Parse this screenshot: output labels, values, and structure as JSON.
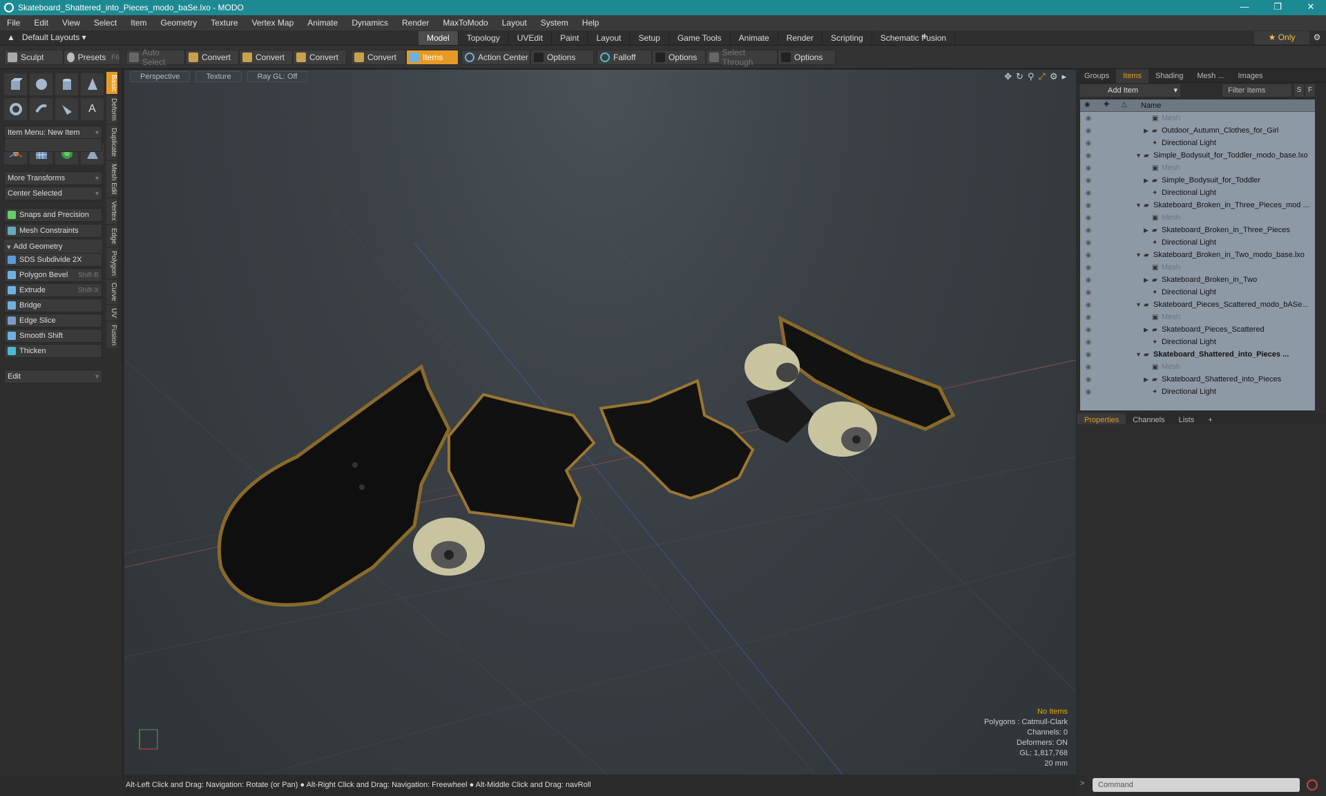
{
  "window": {
    "title": "Skateboard_Shattered_into_Pieces_modo_baSe.lxo - MODO"
  },
  "menu": [
    "File",
    "Edit",
    "View",
    "Select",
    "Item",
    "Geometry",
    "Texture",
    "Vertex Map",
    "Animate",
    "Dynamics",
    "Render",
    "MaxToModo",
    "Layout",
    "System",
    "Help"
  ],
  "layouts": "Default Layouts",
  "modetabs": [
    "Model",
    "Topology",
    "UVEdit",
    "Paint",
    "Layout",
    "Setup",
    "Game Tools",
    "Animate",
    "Render",
    "Scripting",
    "Schematic Fusion"
  ],
  "only_label": "Only",
  "toolbar": {
    "sculpt": "Sculpt",
    "presets": "Presets",
    "presets_key": "F6",
    "auto_select": "Auto Select",
    "convert1": "Convert",
    "convert2": "Convert",
    "convert3": "Convert",
    "convert4": "Convert",
    "items": "Items",
    "action_center": "Action Center",
    "options1": "Options",
    "falloff": "Falloff",
    "options2": "Options",
    "select_through": "Select Through",
    "options3": "Options"
  },
  "left": {
    "item_menu": "Item Menu: New Item",
    "more_transforms": "More Transforms",
    "center_selected": "Center Selected",
    "snaps": "Snaps and Precision",
    "mesh_constraints": "Mesh Constraints",
    "add_geometry": "Add Geometry",
    "tools": [
      {
        "label": "SDS Subdivide 2X",
        "key": ""
      },
      {
        "label": "Polygon Bevel",
        "key": "Shift-B"
      },
      {
        "label": "Extrude",
        "key": "Shift-X"
      },
      {
        "label": "Bridge",
        "key": ""
      },
      {
        "label": "Edge Slice",
        "key": ""
      },
      {
        "label": "Smooth Shift",
        "key": ""
      },
      {
        "label": "Thicken",
        "key": ""
      }
    ],
    "edit": "Edit"
  },
  "vtabs": [
    "Basic",
    "Deform",
    "Duplicate",
    "Mesh Edit",
    "Vertex",
    "Edge",
    "Polygon",
    "Curve",
    "UV",
    "Fusion"
  ],
  "viewport": {
    "perspective": "Perspective",
    "texture": "Texture",
    "raygl": "Ray GL: Off",
    "info": {
      "no_items": "No Items",
      "polygons": "Polygons : Catmull-Clark",
      "channels": "Channels: 0",
      "deformers": "Deformers: ON",
      "gl": "GL: 1,817,768",
      "scale": "20 mm"
    }
  },
  "status": "Alt-Left Click and Drag: Navigation: Rotate (or Pan) ●  Alt-Right Click and Drag: Navigation: Freewheel ●  Alt-Middle Click and Drag: navRoll",
  "right": {
    "tabs": [
      "Groups",
      "Items",
      "Shading",
      "Mesh ...",
      "Images"
    ],
    "add_item": "Add Item",
    "filter": "Filter Items",
    "name_col": "Name",
    "rows": [
      {
        "label": "Mesh",
        "indent": 2,
        "dim": true,
        "arrow": ""
      },
      {
        "label": "Outdoor_Autumn_Clothes_for_Girl",
        "indent": 2,
        "dim": false,
        "arrow": "▶"
      },
      {
        "label": "Directional Light",
        "indent": 2,
        "dim": false,
        "arrow": ""
      },
      {
        "label": "Simple_Bodysuit_for_Toddler_modo_base.lxo",
        "indent": 1,
        "dim": false,
        "arrow": "▼"
      },
      {
        "label": "Mesh",
        "indent": 2,
        "dim": true,
        "arrow": ""
      },
      {
        "label": "Simple_Bodysuit_for_Toddler",
        "indent": 2,
        "dim": false,
        "arrow": "▶"
      },
      {
        "label": "Directional Light",
        "indent": 2,
        "dim": false,
        "arrow": ""
      },
      {
        "label": "Skateboard_Broken_in_Three_Pieces_mod ...",
        "indent": 1,
        "dim": false,
        "arrow": "▼"
      },
      {
        "label": "Mesh",
        "indent": 2,
        "dim": true,
        "arrow": ""
      },
      {
        "label": "Skateboard_Broken_in_Three_Pieces",
        "indent": 2,
        "dim": false,
        "arrow": "▶"
      },
      {
        "label": "Directional Light",
        "indent": 2,
        "dim": false,
        "arrow": ""
      },
      {
        "label": "Skateboard_Broken_in_Two_modo_base.lxo",
        "indent": 1,
        "dim": false,
        "arrow": "▼"
      },
      {
        "label": "Mesh",
        "indent": 2,
        "dim": true,
        "arrow": ""
      },
      {
        "label": "Skateboard_Broken_in_Two",
        "indent": 2,
        "dim": false,
        "arrow": "▶"
      },
      {
        "label": "Directional Light",
        "indent": 2,
        "dim": false,
        "arrow": ""
      },
      {
        "label": "Skateboard_Pieces_Scattered_modo_bASe...",
        "indent": 1,
        "dim": false,
        "arrow": "▼"
      },
      {
        "label": "Mesh",
        "indent": 2,
        "dim": true,
        "arrow": ""
      },
      {
        "label": "Skateboard_Pieces_Scattered",
        "indent": 2,
        "dim": false,
        "arrow": "▶"
      },
      {
        "label": "Directional Light",
        "indent": 2,
        "dim": false,
        "arrow": ""
      },
      {
        "label": "Skateboard_Shattered_into_Pieces ...",
        "indent": 1,
        "dim": false,
        "arrow": "▼",
        "bold": true
      },
      {
        "label": "Mesh",
        "indent": 2,
        "dim": true,
        "arrow": ""
      },
      {
        "label": "Skateboard_Shattered_into_Pieces",
        "indent": 2,
        "dim": false,
        "arrow": "▶"
      },
      {
        "label": "Directional Light",
        "indent": 2,
        "dim": false,
        "arrow": ""
      }
    ],
    "ptabs": [
      "Properties",
      "Channels",
      "Lists"
    ],
    "command": "Command"
  },
  "colors": {
    "accent": "#e69a24",
    "titlebar": "#1d8a93"
  }
}
